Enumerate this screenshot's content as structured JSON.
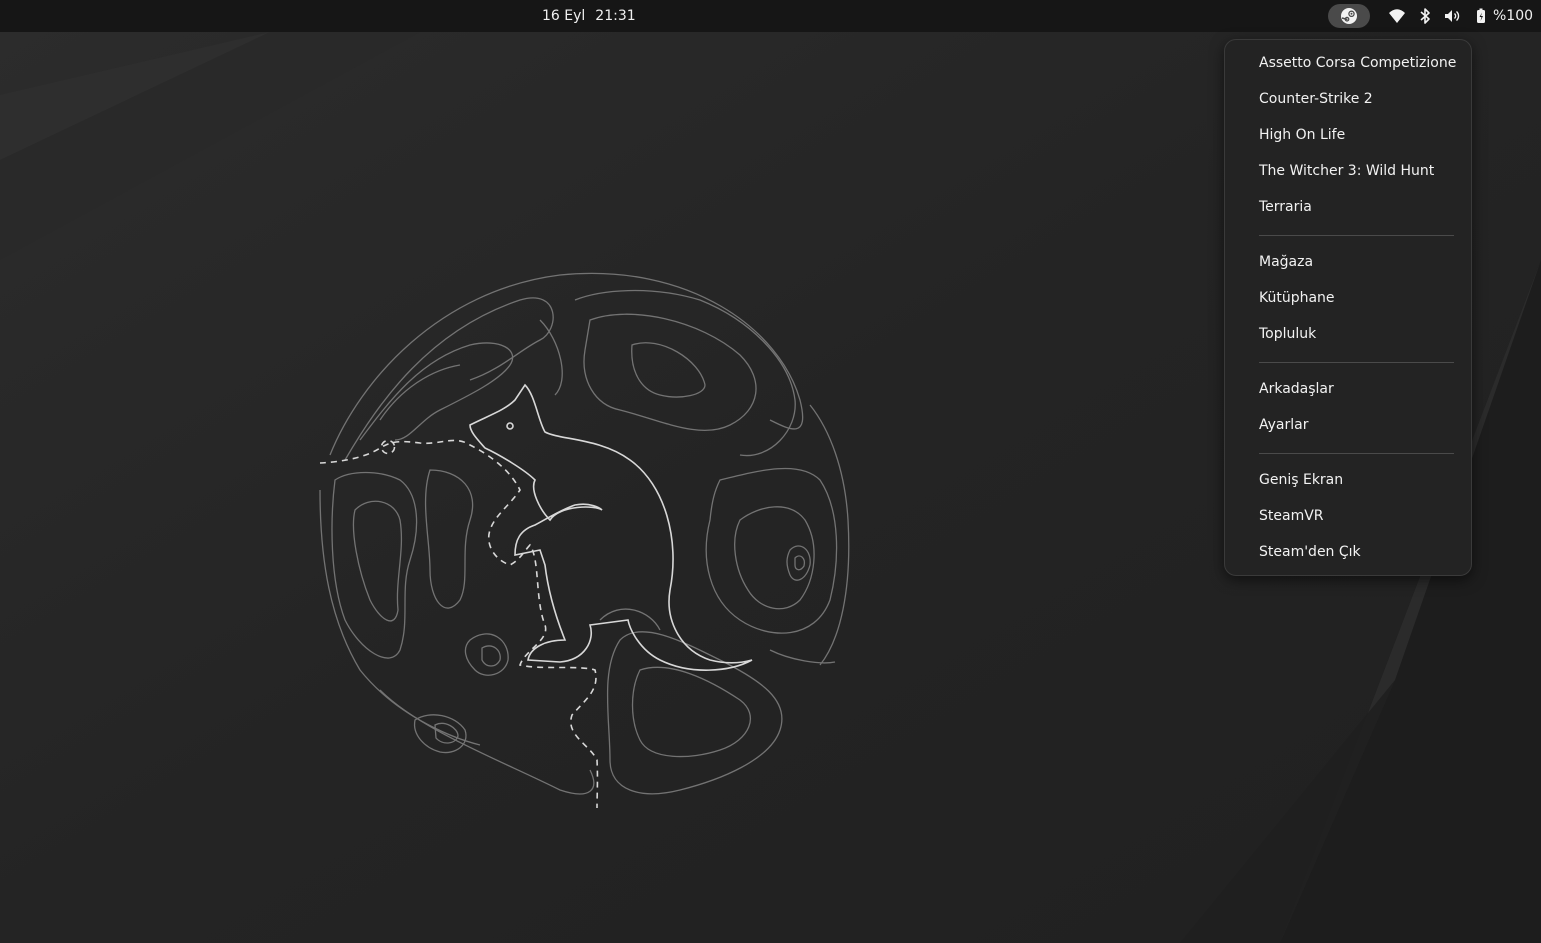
{
  "topbar": {
    "date": "16 Eyl",
    "time": "21:31",
    "battery_percent": "%100",
    "tray_icons": [
      "steam-icon",
      "wifi-icon",
      "bluetooth-icon",
      "volume-icon",
      "battery-icon"
    ]
  },
  "steam_menu": {
    "recent_games": [
      {
        "label": "Assetto Corsa Competizione"
      },
      {
        "label": "Counter-Strike 2"
      },
      {
        "label": "High On Life"
      },
      {
        "label": "The Witcher 3: Wild Hunt"
      },
      {
        "label": "Terraria"
      }
    ],
    "navigation": [
      {
        "label": "Mağaza"
      },
      {
        "label": "Kütüphane"
      },
      {
        "label": "Topluluk"
      }
    ],
    "social": [
      {
        "label": "Arkadaşlar"
      },
      {
        "label": "Ayarlar"
      }
    ],
    "modes": [
      {
        "label": "Geniş Ekran"
      },
      {
        "label": "SteamVR"
      },
      {
        "label": "Steam'den Çık"
      }
    ]
  },
  "colors": {
    "topbar_bg": "#161616",
    "desktop_bg": "#262626",
    "menu_bg": "#232323",
    "text": "#f2f2f2",
    "wallpaper_line": "#8a8a8a"
  }
}
